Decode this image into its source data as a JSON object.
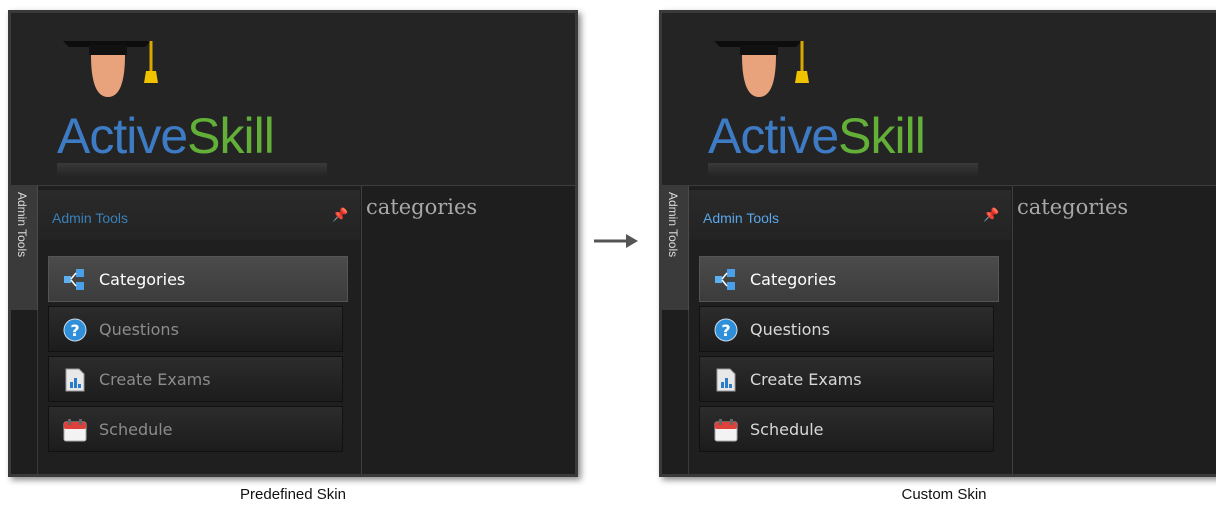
{
  "panels": [
    {
      "logo": {
        "part1": "Active",
        "part2": "Skill"
      },
      "sidebar_tab": "Admin Tools",
      "sidebar_title": "Admin Tools",
      "nav_items": [
        {
          "label": "Categories",
          "icon": "categories-icon",
          "selected": true
        },
        {
          "label": "Questions",
          "icon": "help-question-icon",
          "selected": false
        },
        {
          "label": "Create Exams",
          "icon": "document-chart-icon",
          "selected": false
        },
        {
          "label": "Schedule",
          "icon": "calendar-icon",
          "selected": false
        }
      ],
      "content_title": "categories",
      "caption": "Predefined Skin"
    },
    {
      "logo": {
        "part1": "Active",
        "part2": "Skill"
      },
      "sidebar_tab": "Admin Tools",
      "sidebar_title": "Admin Tools",
      "nav_items": [
        {
          "label": "Categories",
          "icon": "categories-icon",
          "selected": true
        },
        {
          "label": "Questions",
          "icon": "help-question-icon",
          "selected": false
        },
        {
          "label": "Create Exams",
          "icon": "document-chart-icon",
          "selected": false
        },
        {
          "label": "Schedule",
          "icon": "calendar-icon",
          "selected": false
        }
      ],
      "content_title": "categories",
      "caption": "Custom Skin"
    }
  ],
  "colors": {
    "logo_active": "#3d7bc4",
    "logo_skill": "#62b038",
    "panel_bg": "#1e1e1e",
    "selected_item_bg": "#454545"
  }
}
